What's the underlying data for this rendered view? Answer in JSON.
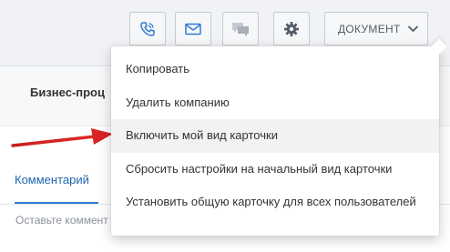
{
  "toolbar": {
    "phone_icon": "phone-icon",
    "mail_icon": "envelope-icon",
    "chat_icon": "chat-icon",
    "settings_icon": "gear-icon",
    "document_label": "ДОКУМЕНТ",
    "accent_color": "#2f7bd3"
  },
  "panel": {
    "business_process_label": "Бизнес-проц"
  },
  "tabs": {
    "comments_label": "Комментарий"
  },
  "comment": {
    "placeholder": "Оставьте коммент"
  },
  "menu": {
    "items": [
      {
        "label": "Копировать"
      },
      {
        "label": "Удалить компанию"
      },
      {
        "label": "Включить мой вид карточки"
      },
      {
        "label": "Сбросить настройки на начальный вид карточки"
      },
      {
        "label": "Установить общую карточку для всех пользователей"
      }
    ],
    "hovered_index": 2
  }
}
